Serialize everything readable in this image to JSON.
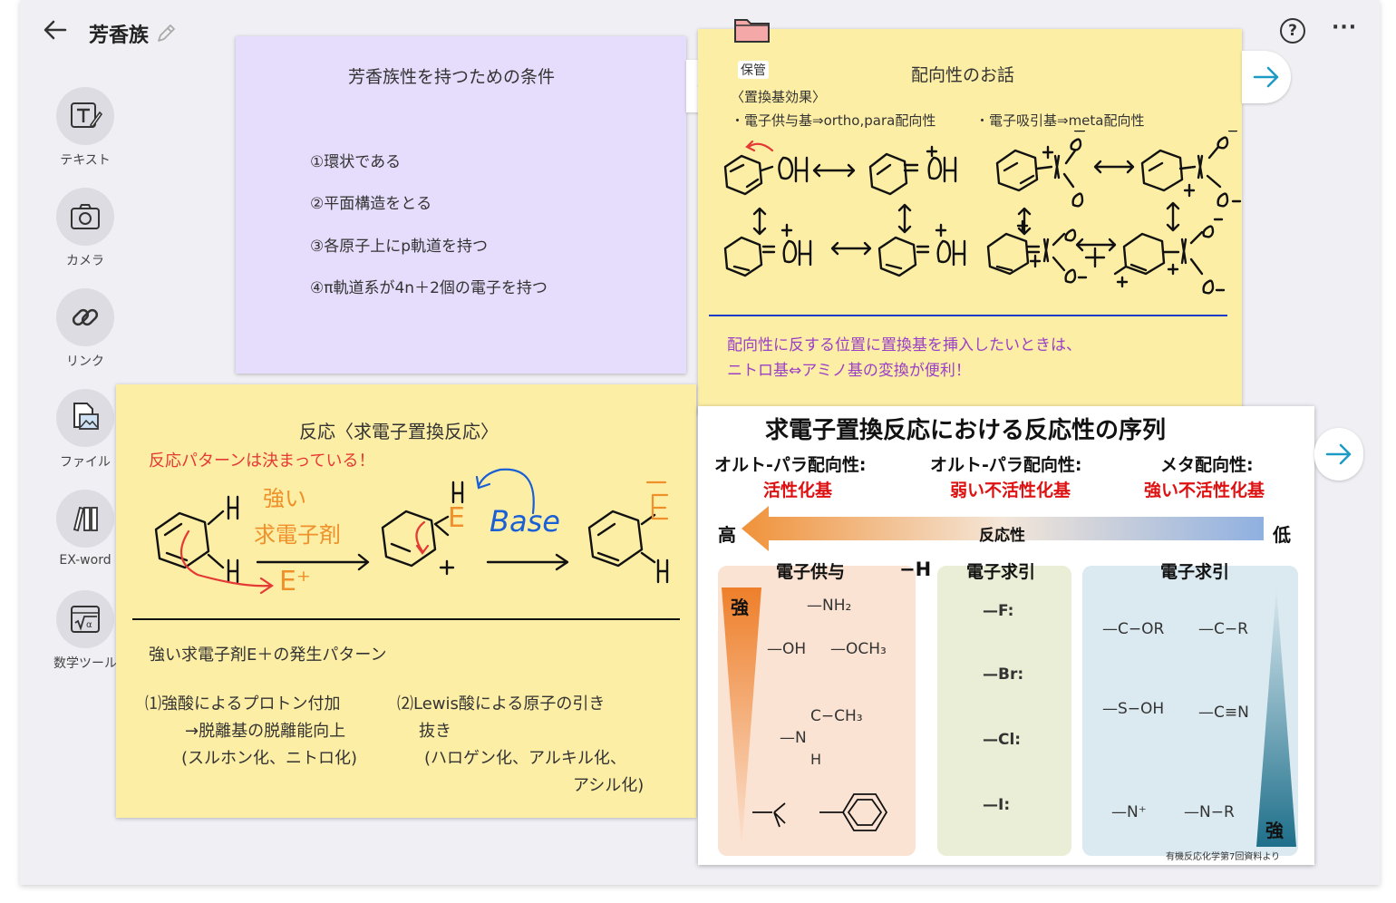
{
  "header": {
    "title": "芳香族",
    "help": "?",
    "more": "···"
  },
  "toolbar": [
    {
      "label": "テキスト",
      "icon": "text-tool-icon"
    },
    {
      "label": "カメラ",
      "icon": "camera-icon"
    },
    {
      "label": "リンク",
      "icon": "link-icon"
    },
    {
      "label": "ファイル",
      "icon": "file-image-icon"
    },
    {
      "label": "EX-word",
      "icon": "books-icon"
    },
    {
      "label": "数学ツール",
      "icon": "math-sqrt-icon"
    }
  ],
  "card_conditions": {
    "title": "芳香族性を持つための条件",
    "items": [
      "①環状である",
      "②平面構造をとる",
      "③各原子上にp軌道を持つ",
      "④π軌道系が4n＋2個の電子を持つ"
    ]
  },
  "card_orientation": {
    "folder_label": "保管",
    "title": "配向性のお話",
    "subtitle": "〈置換基効果〉",
    "bullet_donor": "・電子供与基⇒ortho,para配向性",
    "bullet_acceptor": "・電子吸引基⇒meta配向性",
    "note_line1": "配向性に反する位置に置換基を挿入したいときは、",
    "note_line2": "ニトロ基⇔アミノ基の変換が便利！"
  },
  "card_reaction": {
    "title": "反応〈求電子置換反応〉",
    "subtitle": "反応パターンは決まっている！",
    "hw_strong": "強い",
    "hw_electrophile": "求電子剤",
    "hw_eplus": "E⁺",
    "hw_base": "Base",
    "hw_E": "E",
    "hw_H": "H",
    "hw_plus": "+",
    "gen_title": "強い求電子剤E＋の発生パターン",
    "gen1_line1": "⑴強酸によるプロトン付加",
    "gen1_line2": "→脱離基の脱離能向上",
    "gen1_line3": "(スルホン化、ニトロ化)",
    "gen2_line1": "⑵Lewis酸による原子の引き",
    "gen2_line2": "抜き",
    "gen2_line3": "(ハロゲン化、アルキル化、",
    "gen2_line4": "アシル化)"
  },
  "card_reactivity": {
    "title": "求電子置換反応における反応性の序列",
    "col1_head": "オルト-パラ配向性:",
    "col1_sub": "活性化基",
    "col2_head": "オルト-パラ配向性:",
    "col2_sub": "弱い不活性化基",
    "col3_head": "メタ配向性:",
    "col3_sub": "強い不活性化基",
    "high": "高",
    "low": "低",
    "reactivity": "反応性",
    "donor_head": "電子供与",
    "h_label": "−H",
    "withdraw_head1": "電子求引",
    "withdraw_head2": "電子求引",
    "strong_left": "強",
    "strong_right": "強",
    "donor_groups": [
      "—NH₂",
      "—OH",
      "—OCH₃",
      "C−CH₃",
      "—N",
      "H"
    ],
    "halogens": [
      "—F:",
      "—Br:",
      "—Cl:",
      "—I:"
    ],
    "meta_groups": [
      "—C−OR",
      "—C−R",
      "—S−OH",
      "—C≡N",
      "—N⁺",
      "—N−R"
    ],
    "footnote": "有機反応化学第7回資料より"
  },
  "colors": {
    "purple_card": "#e6dcfb",
    "yellow_card": "#fdeea5",
    "red_text": "#e53935",
    "purple_text": "#9b3fc7",
    "orange_ink": "#f0902a",
    "blue_ink": "#1a5fd6",
    "teal_arrow": "#1e9bc4"
  }
}
